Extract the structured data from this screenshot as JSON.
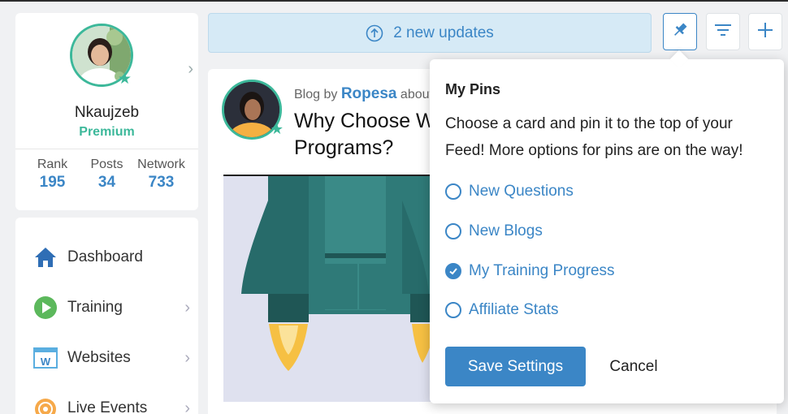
{
  "profile": {
    "name": "Nkaujzeb",
    "tier": "Premium",
    "stats": [
      {
        "label": "Rank",
        "value": "195"
      },
      {
        "label": "Posts",
        "value": "34"
      },
      {
        "label": "Network",
        "value": "733"
      }
    ]
  },
  "nav": {
    "items": [
      {
        "label": "Dashboard",
        "icon": "house-icon"
      },
      {
        "label": "Training",
        "icon": "play-circle-icon"
      },
      {
        "label": "Websites",
        "icon": "website-w-icon"
      },
      {
        "label": "Live Events",
        "icon": "broadcast-icon"
      }
    ]
  },
  "topbar": {
    "updates_label": "2 new updates",
    "tools": [
      "pin-icon",
      "filter-icon",
      "plus-icon"
    ]
  },
  "blog": {
    "meta_prefix": "Blog by",
    "author": "Ropesa",
    "meta_suffix": "about",
    "title": "Why Choose We… Programs?"
  },
  "pins_popup": {
    "title": "My Pins",
    "description": "Choose a card and pin it to the top of your Feed! More options for pins are on the way!",
    "options": [
      {
        "label": "New Questions",
        "checked": false
      },
      {
        "label": "New Blogs",
        "checked": false
      },
      {
        "label": "My Training Progress",
        "checked": true
      },
      {
        "label": "Affiliate Stats",
        "checked": false
      }
    ],
    "save_label": "Save Settings",
    "cancel_label": "Cancel"
  },
  "colors": {
    "accent_blue": "#3b86c6",
    "accent_green": "#3cb89a",
    "updates_bg": "#d6eaf6"
  }
}
